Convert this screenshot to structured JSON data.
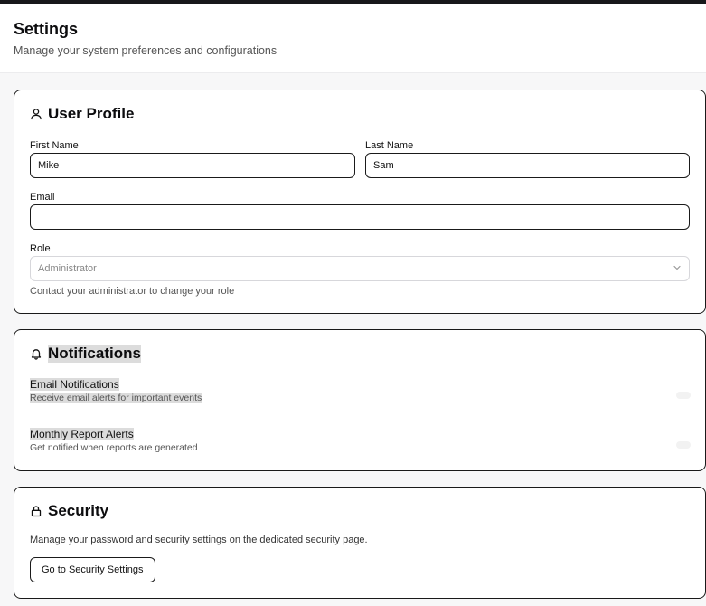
{
  "header": {
    "title": "Settings",
    "subtitle": "Manage your system preferences and configurations"
  },
  "profile": {
    "title": "User Profile",
    "icon": "user-icon",
    "first_name_label": "First Name",
    "first_name_value": "Mike",
    "last_name_label": "Last Name",
    "last_name_value": "Sam",
    "email_label": "Email",
    "email_value": "",
    "role_label": "Role",
    "role_value": "Administrator",
    "role_help": "Contact your administrator to change your role"
  },
  "notifications": {
    "title": "Notifications",
    "icon": "bell-icon",
    "items": [
      {
        "title": "Email Notifications",
        "description": "Receive email alerts for important events"
      },
      {
        "title": "Monthly Report Alerts",
        "description": "Get notified when reports are generated"
      }
    ]
  },
  "security": {
    "title": "Security",
    "icon": "lock-icon",
    "description": "Manage your password and security settings on the dedicated security page.",
    "button_label": "Go to Security Settings"
  }
}
